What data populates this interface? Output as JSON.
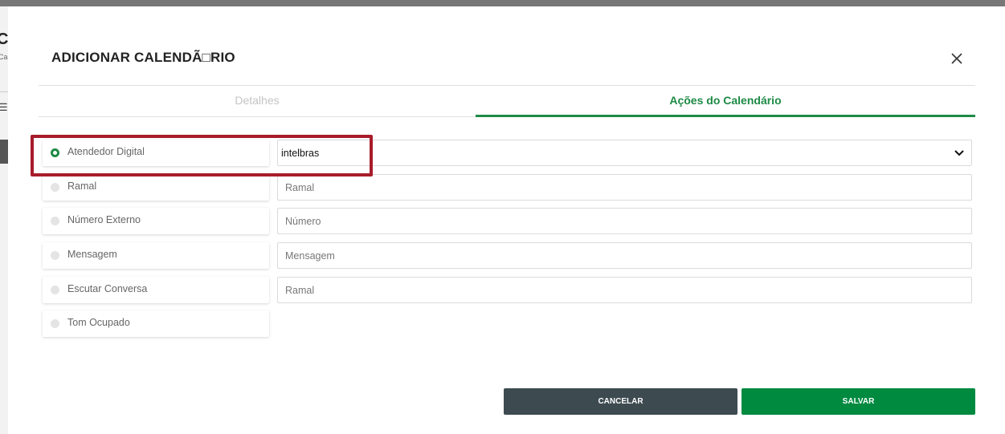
{
  "background": {
    "title_fragment": "C",
    "subtitle_fragment": "Ca"
  },
  "modal": {
    "title": "ADICIONAR CALENDÃ□RIO",
    "close_icon": "close-icon"
  },
  "tabs": [
    {
      "label": "Detalhes",
      "active": false
    },
    {
      "label": "Ações do Calendário",
      "active": true
    }
  ],
  "options": [
    {
      "label": "Atendedor Digital",
      "selected": true
    },
    {
      "label": "Ramal",
      "selected": false
    },
    {
      "label": "Número Externo",
      "selected": false
    },
    {
      "label": "Mensagem",
      "selected": false
    },
    {
      "label": "Escutar Conversa",
      "selected": false
    },
    {
      "label": "Tom Ocupado",
      "selected": false
    }
  ],
  "fields": {
    "digital_attendant_select": {
      "value": "intelbras",
      "icon": "chevron-down-icon"
    },
    "ramal": {
      "placeholder": "Ramal"
    },
    "numero_externo": {
      "placeholder": "Número"
    },
    "mensagem": {
      "placeholder": "Mensagem"
    },
    "escutar_conversa": {
      "placeholder": "Ramal"
    }
  },
  "buttons": {
    "cancel": "CANCELAR",
    "save": "SALVAR"
  },
  "colors": {
    "accent_green": "#1e8a45",
    "save_green": "#008a40",
    "cancel_dark": "#3d4b51",
    "highlight_red": "#a81c2b"
  }
}
